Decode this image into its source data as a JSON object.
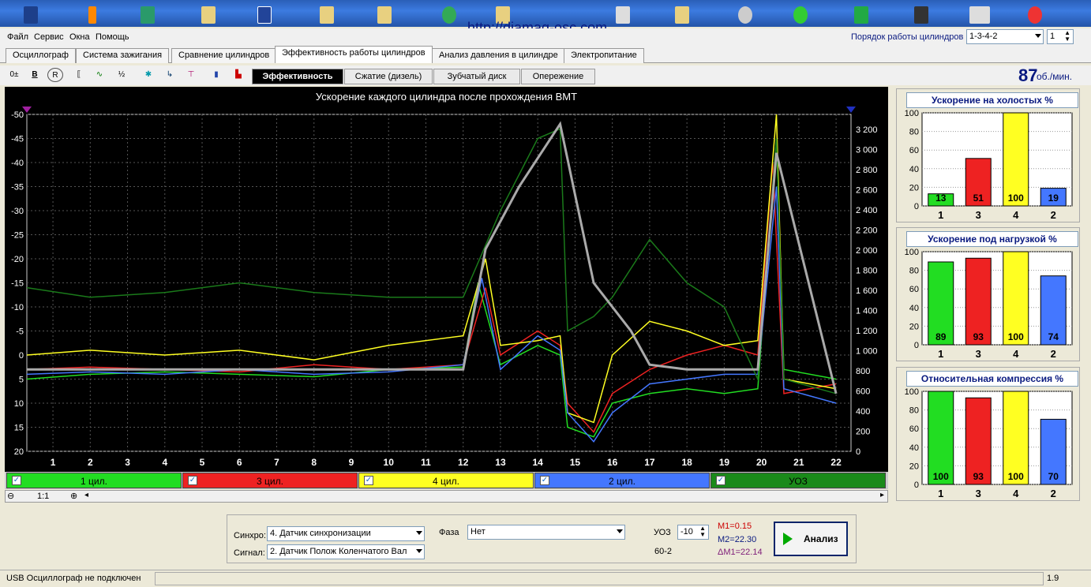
{
  "url_overlay": "http://diamag-osc.com",
  "menu": [
    "Файл",
    "Сервис",
    "Окна",
    "Помощь"
  ],
  "cylinder_order": {
    "label": "Порядок работы цилиндров",
    "value": "1-3-4-2",
    "index": "1"
  },
  "main_tabs": [
    {
      "label": "Осциллограф",
      "active": false
    },
    {
      "label": "Система зажигания",
      "active": false
    },
    {
      "label": "Сравнение цилиндров",
      "active": false
    },
    {
      "label": "Эффективность работы цилиндров",
      "active": true
    },
    {
      "label": "Анализ давления в цилиндре",
      "active": false
    },
    {
      "label": "Электропитание",
      "active": false
    }
  ],
  "sub_tabs": [
    {
      "label": "Эффективность",
      "active": true
    },
    {
      "label": "Сжатие (дизель)",
      "active": false
    },
    {
      "label": "Зубчатый диск",
      "active": false
    },
    {
      "label": "Опережение",
      "active": false
    }
  ],
  "rpm": {
    "value": "87",
    "unit": "об./мин."
  },
  "chart_data": {
    "type": "line",
    "title": "Ускорение каждого цилиндра после прохождения ВМТ",
    "x_ticks": [
      "1",
      "2",
      "3",
      "4",
      "5",
      "6",
      "7",
      "8",
      "9",
      "10",
      "11",
      "12",
      "13",
      "14",
      "15",
      "16",
      "17",
      "18",
      "19",
      "20",
      "21",
      "22"
    ],
    "y_left_ticks": [
      "-50",
      "-45",
      "-40",
      "-35",
      "-30",
      "-25",
      "-20",
      "-15",
      "-10",
      "-5",
      "0",
      "5",
      "10",
      "15",
      "20"
    ],
    "y_right_ticks": [
      "3 200",
      "3 000",
      "2 800",
      "2 600",
      "2 400",
      "2 200",
      "2 000",
      "1 800",
      "1 600",
      "1 400",
      "1 200",
      "1 000",
      "800",
      "600",
      "400",
      "200",
      "0"
    ],
    "y_left_range": [
      20,
      -50
    ],
    "y_right_range": [
      0,
      3350
    ],
    "x_range": [
      0.3,
      22.4
    ],
    "series": [
      {
        "name": "1 цил.",
        "color": "#22dd22",
        "values": [
          [
            0.3,
            5
          ],
          [
            2,
            4
          ],
          [
            4,
            3.5
          ],
          [
            6,
            4
          ],
          [
            8,
            4.5
          ],
          [
            10,
            3
          ],
          [
            12,
            2.5
          ],
          [
            12.4,
            -15
          ],
          [
            13,
            2
          ],
          [
            14,
            -2
          ],
          [
            14.6,
            0
          ],
          [
            14.8,
            15
          ],
          [
            15.5,
            17
          ],
          [
            16,
            10
          ],
          [
            17,
            8
          ],
          [
            18,
            7
          ],
          [
            19,
            8
          ],
          [
            19.9,
            7
          ],
          [
            20.4,
            -45
          ],
          [
            20.6,
            3
          ],
          [
            22,
            5
          ]
        ]
      },
      {
        "name": "3 цил.",
        "color": "#ee2222",
        "values": [
          [
            0.3,
            3
          ],
          [
            2,
            2.5
          ],
          [
            4,
            3
          ],
          [
            6,
            3.5
          ],
          [
            8,
            2
          ],
          [
            10,
            3
          ],
          [
            12,
            2
          ],
          [
            12.6,
            -14
          ],
          [
            13,
            0
          ],
          [
            14,
            -5
          ],
          [
            14.6,
            -2
          ],
          [
            14.8,
            10
          ],
          [
            15.5,
            16
          ],
          [
            16,
            8
          ],
          [
            17,
            3
          ],
          [
            18,
            0
          ],
          [
            19,
            -2
          ],
          [
            19.9,
            0
          ],
          [
            20.3,
            -40
          ],
          [
            20.6,
            8
          ],
          [
            22,
            6
          ]
        ]
      },
      {
        "name": "4 цил.",
        "color": "#ffff22",
        "values": [
          [
            0.3,
            0
          ],
          [
            2,
            -1
          ],
          [
            4,
            0
          ],
          [
            6,
            -1
          ],
          [
            8,
            1
          ],
          [
            10,
            -2
          ],
          [
            12,
            -4
          ],
          [
            12.6,
            -20
          ],
          [
            13,
            -2
          ],
          [
            14,
            -3
          ],
          [
            14.6,
            -4
          ],
          [
            14.8,
            12
          ],
          [
            15.5,
            14
          ],
          [
            16,
            0
          ],
          [
            17,
            -7
          ],
          [
            18,
            -5
          ],
          [
            19,
            -2
          ],
          [
            19.9,
            -3
          ],
          [
            20.4,
            -50
          ],
          [
            20.6,
            5
          ],
          [
            22,
            7
          ]
        ]
      },
      {
        "name": "2 цил.",
        "color": "#4477ff",
        "values": [
          [
            0.3,
            4
          ],
          [
            2,
            3.5
          ],
          [
            4,
            4
          ],
          [
            6,
            3
          ],
          [
            8,
            4
          ],
          [
            10,
            3.5
          ],
          [
            12,
            2
          ],
          [
            12.5,
            -16
          ],
          [
            13,
            3
          ],
          [
            14,
            -4
          ],
          [
            14.6,
            -1
          ],
          [
            14.8,
            12
          ],
          [
            15.5,
            18
          ],
          [
            16,
            12
          ],
          [
            17,
            6
          ],
          [
            18,
            5
          ],
          [
            19,
            4
          ],
          [
            19.9,
            4
          ],
          [
            20.4,
            -35
          ],
          [
            20.6,
            7
          ],
          [
            22,
            10
          ]
        ]
      },
      {
        "name": "УОЗ",
        "color": "#1a7a1a",
        "values": [
          [
            0.3,
            -14
          ],
          [
            2,
            -12
          ],
          [
            4,
            -13
          ],
          [
            6,
            -15
          ],
          [
            8,
            -13
          ],
          [
            10,
            -12
          ],
          [
            12,
            -12
          ],
          [
            13,
            -30
          ],
          [
            14,
            -45
          ],
          [
            14.6,
            -47
          ],
          [
            14.8,
            -5
          ],
          [
            15.5,
            -8
          ],
          [
            16,
            -12
          ],
          [
            17,
            -24
          ],
          [
            18,
            -15
          ],
          [
            19,
            -10
          ],
          [
            19.9,
            5
          ],
          [
            20.4,
            -45
          ],
          [
            20.6,
            5
          ],
          [
            22,
            8
          ]
        ]
      },
      {
        "name": "RPM",
        "color": "#aaaaaa",
        "values": [
          [
            0.3,
            3
          ],
          [
            4,
            3
          ],
          [
            8,
            3
          ],
          [
            12,
            3
          ],
          [
            12.6,
            -22
          ],
          [
            13.5,
            -35
          ],
          [
            14.6,
            -48
          ],
          [
            15.5,
            -15
          ],
          [
            16.5,
            -5
          ],
          [
            17,
            2
          ],
          [
            18,
            3
          ],
          [
            19.9,
            3
          ],
          [
            20.4,
            -42
          ],
          [
            22,
            8
          ]
        ]
      }
    ]
  },
  "legend": [
    {
      "name": "1 цил.",
      "color": "#22dd22"
    },
    {
      "name": "3 цил.",
      "color": "#ee2222"
    },
    {
      "name": "4 цил.",
      "color": "#ffff22"
    },
    {
      "name": "2 цил.",
      "color": "#4477ff"
    },
    {
      "name": "УОЗ",
      "color": "#1a8a1a"
    }
  ],
  "zoom_label": "1:1",
  "bar_panels": [
    {
      "title": "Ускорение на холостых %",
      "cats": [
        "1",
        "3",
        "4",
        "2"
      ],
      "values": [
        13,
        51,
        100,
        19
      ],
      "colors": [
        "#22dd22",
        "#ee2222",
        "#ffff22",
        "#4477ff"
      ]
    },
    {
      "title": "Ускорение под нагрузкой %",
      "cats": [
        "1",
        "3",
        "4",
        "2"
      ],
      "values": [
        89,
        93,
        100,
        74
      ],
      "colors": [
        "#22dd22",
        "#ee2222",
        "#ffff22",
        "#4477ff"
      ]
    },
    {
      "title": "Относительная компрессия %",
      "cats": [
        "1",
        "3",
        "4",
        "2"
      ],
      "values": [
        100,
        93,
        100,
        70
      ],
      "colors": [
        "#22dd22",
        "#ee2222",
        "#ffff22",
        "#4477ff"
      ]
    }
  ],
  "bar_y_ticks": [
    "100",
    "80",
    "60",
    "40",
    "20",
    "0"
  ],
  "controls": {
    "sync_label": "Синхро:",
    "sync_value": "4.  Датчик синхронизации",
    "signal_label": "Сигнал:",
    "signal_value": "2.  Датчик Полож Коленчатого Вал",
    "phase_label": "Фаза",
    "phase_value": "Нет",
    "uoz_label": "УОЗ",
    "uoz_value": "-10",
    "teeth": "60-2",
    "m1": "M1=0.15",
    "m2": "M2=22.30",
    "dm": "ΔM1=22.14",
    "analyze": "Анализ"
  },
  "status": {
    "left": "USB Осциллограф не подключен",
    "right": "1.9"
  }
}
